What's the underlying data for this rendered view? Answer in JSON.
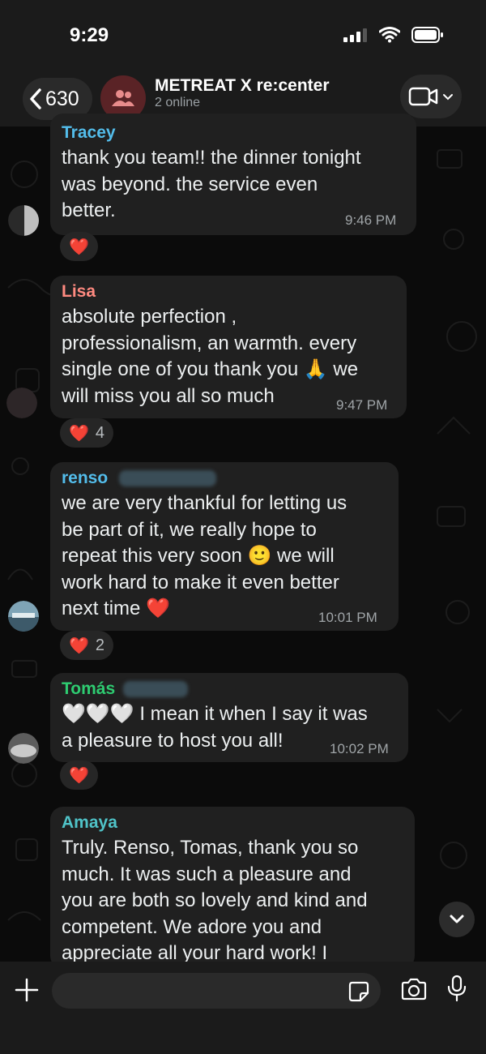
{
  "status_bar": {
    "time": "9:29"
  },
  "header": {
    "back_count": "630",
    "chat_title": "METREAT X re:center",
    "chat_subtitle": "2 online"
  },
  "messages": [
    {
      "sender": "Tracey",
      "sender_color": "#53bdeb",
      "lines": [
        "thank you team!! the dinner tonight",
        "was beyond. the service even",
        "better."
      ],
      "time": "9:46 PM",
      "reaction": {
        "emoji": "❤️",
        "count": ""
      }
    },
    {
      "sender": "Lisa",
      "sender_color": "#ff8a80",
      "lines": [
        "absolute perfection ,",
        "professionalism, an warmth. every",
        "single one of you thank you 🙏 we",
        "will miss you all so much"
      ],
      "time": "9:47 PM",
      "reaction": {
        "emoji": "❤️",
        "count": "4"
      }
    },
    {
      "sender": "renso",
      "sender_color": "#53bdeb",
      "lines": [
        "we are very thankful for letting us",
        "be part of it, we really hope to",
        "repeat this very soon 🙂 we will",
        "work hard to make it even better",
        "next time ❤️"
      ],
      "time": "10:01 PM",
      "reaction": {
        "emoji": "❤️",
        "count": "2"
      }
    },
    {
      "sender": "Tomás",
      "sender_color": "#2ecc71",
      "lines": [
        "🤍🤍🤍 I mean it when I say it was",
        "a pleasure to host you all!"
      ],
      "time": "10:02 PM",
      "reaction": {
        "emoji": "❤️",
        "count": ""
      }
    },
    {
      "sender": "Amaya",
      "sender_color": "#4fc3c8",
      "lines": [
        "Truly. Renso, Tomas, thank you so",
        "much. It was such a pleasure and",
        "you are both so lovely and kind and",
        "competent. We adore you and",
        "appreciate all your hard work! I"
      ],
      "time": "",
      "reaction": null
    }
  ],
  "icons": {
    "back": "chevron-left-icon",
    "group": "group-people-icon",
    "video": "video-camera-icon",
    "scroll": "chevron-down-icon",
    "attach": "plus-icon",
    "sticker": "sticker-icon",
    "camera": "camera-icon",
    "mic": "microphone-icon"
  }
}
